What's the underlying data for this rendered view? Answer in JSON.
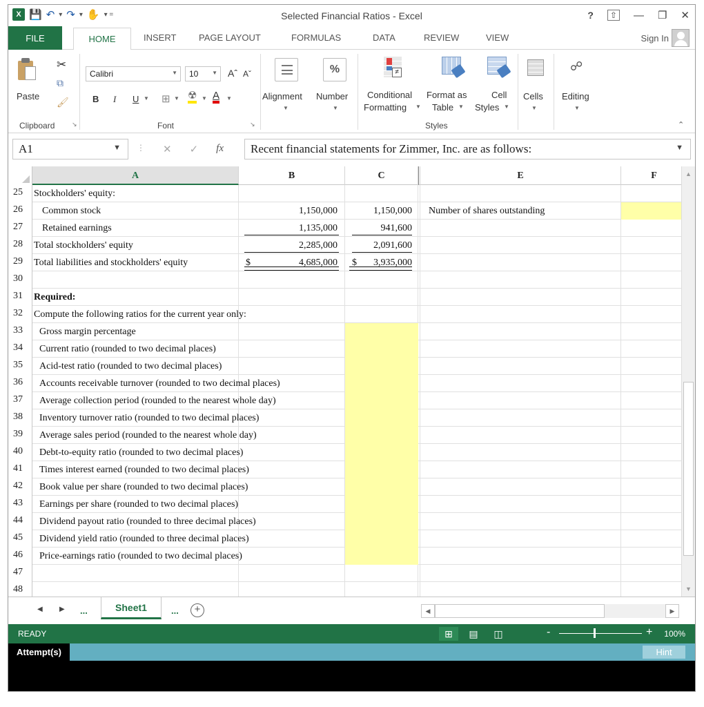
{
  "window": {
    "title": "Selected Financial Ratios - Excel",
    "help": "?",
    "controls": [
      "—",
      "❐",
      "✕"
    ]
  },
  "ribbon_tabs": [
    "FILE",
    "HOME",
    "INSERT",
    "PAGE LAYOUT",
    "FORMULAS",
    "DATA",
    "REVIEW",
    "VIEW"
  ],
  "sign_in": "Sign In",
  "ribbon": {
    "paste": "Paste",
    "clipboard": "Clipboard",
    "font_name": "Calibri",
    "font_size": "10",
    "font_group": "Font",
    "bold": "B",
    "italic": "I",
    "underline": "U",
    "alignment": "Alignment",
    "number": "Number",
    "number_symbol": "%",
    "conditional_formatting_1": "Conditional",
    "conditional_formatting_2": "Formatting",
    "format_as_table_1": "Format as",
    "format_as_table_2": "Table",
    "cell_styles_1": "Cell",
    "cell_styles_2": "Styles",
    "styles_group": "Styles",
    "cells": "Cells",
    "editing": "Editing"
  },
  "formula_bar": {
    "name_box": "A1",
    "fx": "fx",
    "content": "Recent financial statements for Zimmer, Inc. are as follows:"
  },
  "columns": [
    "A",
    "B",
    "C",
    "",
    "E",
    "F"
  ],
  "rows": [
    {
      "num": "25",
      "a": "Stockholders' equity:",
      "b": "",
      "c": "",
      "e": ""
    },
    {
      "num": "26",
      "a": "Common stock",
      "b": "1,150,000",
      "c": "1,150,000",
      "e": "Number of shares outstanding"
    },
    {
      "num": "27",
      "a": "Retained earnings",
      "b": "1,135,000",
      "c": "941,600",
      "e": ""
    },
    {
      "num": "28",
      "a": "Total stockholders' equity",
      "b": "2,285,000",
      "c": "2,091,600",
      "e": ""
    },
    {
      "num": "29",
      "a": "Total liabilities and stockholders' equity",
      "b": "4,685,000",
      "c": "3,935,000",
      "b_prefix": "$",
      "c_prefix": "$",
      "e": ""
    },
    {
      "num": "30",
      "a": ""
    },
    {
      "num": "31",
      "a": "Required:"
    },
    {
      "num": "32",
      "a": "Compute the following ratios for the current year only:"
    },
    {
      "num": "33",
      "a": "Gross margin percentage"
    },
    {
      "num": "34",
      "a": "Current ratio (rounded to two decimal places)"
    },
    {
      "num": "35",
      "a": "Acid-test ratio (rounded to two decimal places)"
    },
    {
      "num": "36",
      "a": "Accounts receivable turnover (rounded to two decimal places)"
    },
    {
      "num": "37",
      "a": "Average collection period (rounded to the nearest whole day)"
    },
    {
      "num": "38",
      "a": "Inventory turnover ratio (rounded to two decimal places)"
    },
    {
      "num": "39",
      "a": "Average sales period (rounded to the nearest whole day)"
    },
    {
      "num": "40",
      "a": "Debt-to-equity ratio (rounded to two decimal places)"
    },
    {
      "num": "41",
      "a": "Times interest earned (rounded to two decimal places)"
    },
    {
      "num": "42",
      "a": "Book value per share (rounded to two decimal places)"
    },
    {
      "num": "43",
      "a": "Earnings per share (rounded to two decimal places)"
    },
    {
      "num": "44",
      "a": "Dividend payout ratio (rounded to three decimal places)"
    },
    {
      "num": "45",
      "a": "Dividend yield ratio (rounded to three decimal places)"
    },
    {
      "num": "46",
      "a": "Price-earnings ratio (rounded to two decimal places)"
    },
    {
      "num": "47",
      "a": ""
    },
    {
      "num": "48",
      "a": ""
    }
  ],
  "sheets": {
    "active": "Sheet1",
    "ellipsis": "...",
    "add": "+"
  },
  "status": {
    "ready": "READY",
    "zoom": "100%",
    "minus": "-",
    "plus": "+"
  },
  "attempt": {
    "label": "Attempt(s)",
    "hint": "Hint"
  },
  "colors": {
    "excel_green": "#217346",
    "input_yellow": "#ffffa8",
    "attempt_bar": "#63afc1"
  }
}
